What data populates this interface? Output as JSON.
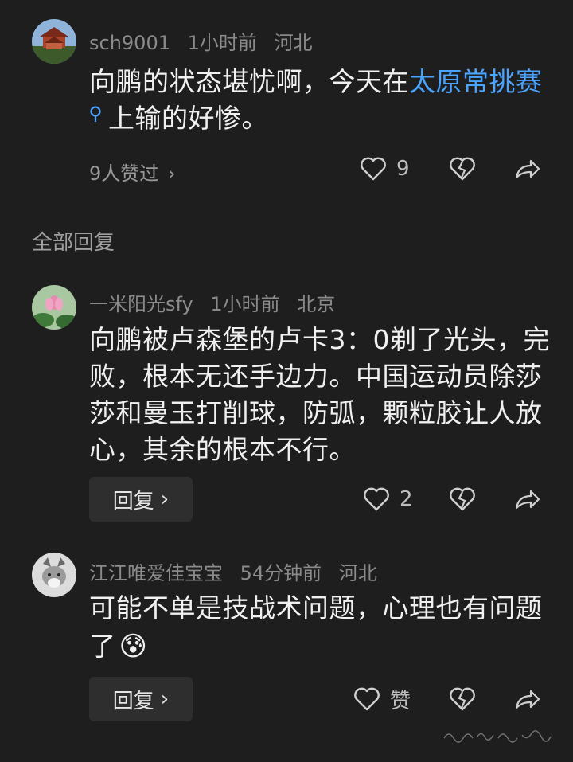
{
  "post": {
    "username": "sch9001",
    "time": "1小时前",
    "location": "河北",
    "text_before": "向鹏的状态堪忧啊，今天在",
    "link_text": "太原常挑赛",
    "text_after": "上输的好惨。",
    "likers_text": "9人赞过",
    "like_count": "9"
  },
  "section_title": "全部回复",
  "replies": [
    {
      "username": "一米阳光sfy",
      "time": "1小时前",
      "location": "北京",
      "text": "向鹏被卢森堡的卢卡3：0剃了光头，完败，根本无还手边力。中国运动员除莎莎和曼玉打削球，防弧，颗粒胶让人放心，其余的根本不行。",
      "reply_label": "回复",
      "like_count": "2"
    },
    {
      "username": "江江唯爱佳宝宝",
      "time": "54分钟前",
      "location": "河北",
      "text": "可能不单是技战术问题，心理也有问题了",
      "emoji": "😰",
      "reply_label": "回复",
      "like_label": "赞"
    }
  ],
  "colors": {
    "background": "#1e1e1e",
    "link": "#4aa3ff",
    "meta": "#8a8a8a"
  }
}
